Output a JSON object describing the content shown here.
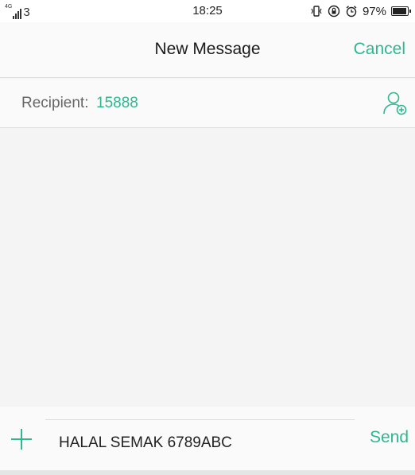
{
  "status_bar": {
    "network_type": "4G",
    "sim_number": "3",
    "time": "18:25",
    "battery_percent": "97%",
    "battery_level": 0.97,
    "icons": [
      "vibrate-icon",
      "rotation-lock-icon",
      "alarm-icon",
      "battery-icon"
    ]
  },
  "header": {
    "title": "New Message",
    "cancel_label": "Cancel"
  },
  "recipient": {
    "label": "Recipient:",
    "value": "15888",
    "add_contact_icon": "add-contact-icon"
  },
  "composer": {
    "attach_icon": "plus-icon",
    "message_text": "HALAL SEMAK 6789ABC",
    "send_label": "Send"
  },
  "colors": {
    "accent": "#2fb88f",
    "background": "#f4f4f4",
    "divider": "#dcdcdc"
  }
}
